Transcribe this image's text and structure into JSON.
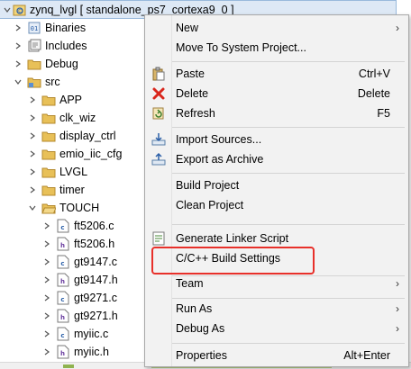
{
  "tree": {
    "root": {
      "label": "zynq_lvgl [ standalone_ps7_cortexa9_0 ]"
    },
    "top_items": [
      {
        "label": "Binaries",
        "icon": "binaries-icon"
      },
      {
        "label": "Includes",
        "icon": "includes-icon"
      },
      {
        "label": "Debug",
        "icon": "folder-icon"
      },
      {
        "label": "src",
        "icon": "source-folder-icon"
      }
    ],
    "src_children": [
      {
        "label": "APP"
      },
      {
        "label": "clk_wiz"
      },
      {
        "label": "display_ctrl"
      },
      {
        "label": "emio_iic_cfg"
      },
      {
        "label": "LVGL"
      },
      {
        "label": "timer"
      },
      {
        "label": "TOUCH"
      }
    ],
    "touch_files": [
      {
        "label": "ft5206.c",
        "badge": "c"
      },
      {
        "label": "ft5206.h",
        "badge": "h"
      },
      {
        "label": "gt9147.c",
        "badge": "c"
      },
      {
        "label": "gt9147.h",
        "badge": "h"
      },
      {
        "label": "gt9271.c",
        "badge": "c"
      },
      {
        "label": "gt9271.h",
        "badge": "h"
      },
      {
        "label": "myiic.c",
        "badge": "c"
      },
      {
        "label": "myiic.h",
        "badge": "h"
      }
    ]
  },
  "menu": {
    "items": [
      {
        "label": "New",
        "shortcut": "",
        "submenu": true,
        "icon": ""
      },
      {
        "label": "Move To System Project...",
        "shortcut": "",
        "submenu": false,
        "icon": ""
      },
      {
        "label": "Paste",
        "shortcut": "Ctrl+V",
        "submenu": false,
        "icon": "paste-icon"
      },
      {
        "label": "Delete",
        "shortcut": "Delete",
        "submenu": false,
        "icon": "delete-icon"
      },
      {
        "label": "Refresh",
        "shortcut": "F5",
        "submenu": false,
        "icon": "refresh-icon"
      },
      {
        "label": "Import Sources...",
        "shortcut": "",
        "submenu": false,
        "icon": "import-icon"
      },
      {
        "label": "Export as Archive",
        "shortcut": "",
        "submenu": false,
        "icon": "export-icon"
      },
      {
        "label": "Build Project",
        "shortcut": "",
        "submenu": false,
        "icon": ""
      },
      {
        "label": "Clean Project",
        "shortcut": "",
        "submenu": false,
        "icon": ""
      },
      {
        "label": "Generate Linker Script",
        "shortcut": "",
        "submenu": false,
        "icon": "linker-script-icon"
      },
      {
        "label": "C/C++ Build Settings",
        "shortcut": "",
        "submenu": false,
        "icon": ""
      },
      {
        "label": "Team",
        "shortcut": "",
        "submenu": true,
        "icon": ""
      },
      {
        "label": "Run As",
        "shortcut": "",
        "submenu": true,
        "icon": ""
      },
      {
        "label": "Debug As",
        "shortcut": "",
        "submenu": true,
        "icon": ""
      },
      {
        "label": "Properties",
        "shortcut": "Alt+Enter",
        "submenu": false,
        "icon": ""
      }
    ],
    "submenu_arrow": "›"
  },
  "colors": {
    "highlight_box": "#e8302a",
    "root_selection": "#dde8f5",
    "folder": "#e8c058"
  }
}
